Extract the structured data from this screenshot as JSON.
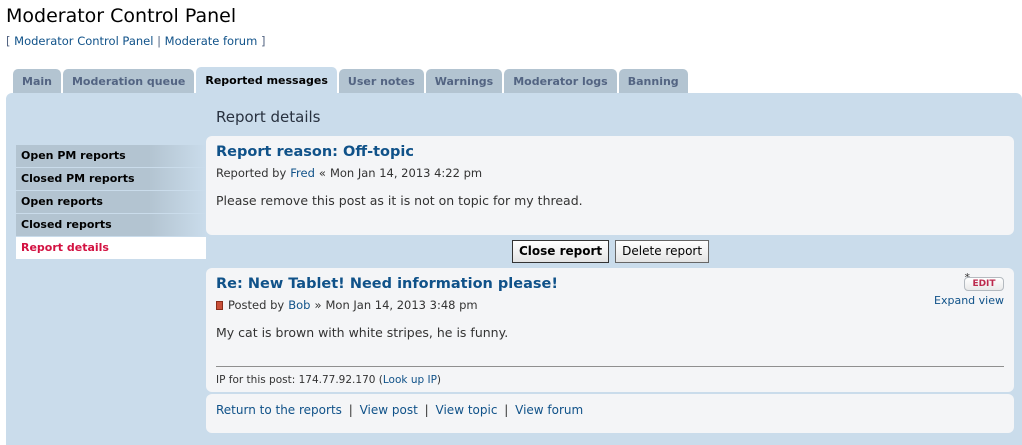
{
  "page": {
    "title": "Moderator Control Panel",
    "breadcrumb": {
      "open": "[",
      "items": [
        "Moderator Control Panel",
        "Moderate forum"
      ],
      "sep": "|",
      "close": "]"
    }
  },
  "tabs": [
    {
      "label": "Main",
      "active": false
    },
    {
      "label": "Moderation queue",
      "active": false
    },
    {
      "label": "Reported messages",
      "active": true
    },
    {
      "label": "User notes",
      "active": false
    },
    {
      "label": "Warnings",
      "active": false
    },
    {
      "label": "Moderator logs",
      "active": false
    },
    {
      "label": "Banning",
      "active": false
    }
  ],
  "sidebar": {
    "items": [
      {
        "label": "Open PM reports",
        "active": false
      },
      {
        "label": "Closed PM reports",
        "active": false
      },
      {
        "label": "Open reports",
        "active": false
      },
      {
        "label": "Closed reports",
        "active": false
      },
      {
        "label": "Report details",
        "active": true
      }
    ]
  },
  "report": {
    "section_title": "Report details",
    "reason_title": "Report reason: Off-topic",
    "reported_by_prefix": "Reported by",
    "reporter": "Fred",
    "reported_sep": "«",
    "reported_date": "Mon Jan 14, 2013 4:22 pm",
    "text": "Please remove this post as it is not on topic for my thread."
  },
  "actions": {
    "close": "Close report",
    "delete": "Delete report"
  },
  "post": {
    "title": "Re: New Tablet! Need information please!",
    "posted_by_prefix": "Posted by",
    "author": "Bob",
    "posted_sep": "»",
    "posted_date": "Mon Jan 14, 2013 3:48 pm",
    "text": "My cat is brown with white stripes, he is funny.",
    "edit_label": "EDIT",
    "star": "*",
    "expand_label": "Expand view",
    "ip_label": "IP for this post:",
    "ip": "174.77.92.170",
    "ip_lookup": "Look up IP"
  },
  "footer_links": [
    "Return to the reports",
    "View post",
    "View topic",
    "View forum"
  ],
  "footer_sep": "|",
  "colors": {
    "panel_bg": "#cadceb",
    "tab_bg": "#b3c4d1",
    "link": "#105289",
    "active_side": "#d31141"
  }
}
